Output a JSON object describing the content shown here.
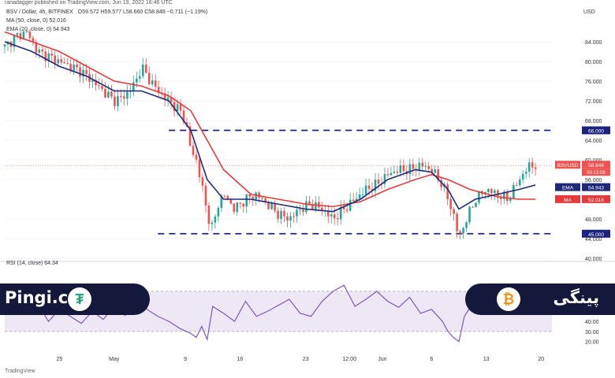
{
  "publisher_line": "ranadagger published on TradingView.com, Jun 19, 2022 16:46 UTC",
  "symbol_line": "BSV / Dollar, 4h, BITFINEX",
  "ohlc": "O59.572  H59.577  L58.660  C58.848  −0.711 (−1.19%)",
  "ma_line": "MA (50, close, 0)  52.016",
  "ema_line": "EMA (20, close, 0)  54.943",
  "rsi_line": "RSI (14, close)  64.34",
  "currency": "USD",
  "watermark_left": "Pingi.co",
  "watermark_right": "پینگی",
  "tradingview_logo": "TradingView",
  "colors": {
    "candle_up": "#26a69a",
    "candle_down": "#ef5350",
    "ema": "#1e2a78",
    "ma": "#e5393b",
    "level": "#1a237e",
    "rsi": "#7e57c2",
    "rsi_band": "#ede7f6"
  },
  "chart_data": {
    "type": "line",
    "price_axis": {
      "ticks": [
        "84.000",
        "80.000",
        "76.000",
        "72.000",
        "68.000",
        "64.000",
        "60.000",
        "56.000",
        "48.000",
        "44.000",
        "40.000"
      ],
      "min": 40,
      "max": 88
    },
    "rsi_axis": {
      "ticks": [
        "70.00",
        "60.00",
        "40.00",
        "30.00",
        "20.00"
      ],
      "min": 15,
      "max": 95,
      "band": [
        30,
        70
      ]
    },
    "x_ticks": [
      "25",
      "May",
      "9",
      "16",
      "23",
      "12:00",
      "Jun",
      "6",
      "13",
      "20"
    ],
    "levels": [
      {
        "label": "66.000",
        "value": 66
      },
      {
        "label": "45.000",
        "value": 45
      }
    ],
    "badges": [
      {
        "label": "BSVUSD",
        "value": "58.848",
        "sub": "03:13:09",
        "price": 58.85,
        "color": "#ef5350"
      },
      {
        "label": "EMA",
        "value": "54.943",
        "price": 54.94,
        "color": "#1e2a78"
      },
      {
        "label": "MA",
        "value": "52.016",
        "price": 52.02,
        "color": "#e5393b"
      }
    ],
    "rsi_badge": {
      "label": "RSI",
      "value": "64.34",
      "level": 64.34
    },
    "price_path": [
      [
        0,
        83
      ],
      [
        0.02,
        85
      ],
      [
        0.04,
        86
      ],
      [
        0.06,
        82
      ],
      [
        0.08,
        81
      ],
      [
        0.1,
        80
      ],
      [
        0.12,
        79
      ],
      [
        0.14,
        78
      ],
      [
        0.16,
        76
      ],
      [
        0.18,
        74
      ],
      [
        0.2,
        72
      ],
      [
        0.22,
        73
      ],
      [
        0.24,
        76
      ],
      [
        0.25,
        79
      ],
      [
        0.26,
        77
      ],
      [
        0.28,
        74
      ],
      [
        0.3,
        72
      ],
      [
        0.32,
        70
      ],
      [
        0.33,
        68
      ],
      [
        0.34,
        62
      ],
      [
        0.35,
        60
      ],
      [
        0.36,
        55
      ],
      [
        0.37,
        49
      ],
      [
        0.38,
        46
      ],
      [
        0.39,
        51
      ],
      [
        0.4,
        53
      ],
      [
        0.42,
        50
      ],
      [
        0.44,
        52
      ],
      [
        0.46,
        53
      ],
      [
        0.48,
        51
      ],
      [
        0.5,
        49
      ],
      [
        0.52,
        48
      ],
      [
        0.54,
        50
      ],
      [
        0.56,
        51
      ],
      [
        0.58,
        50
      ],
      [
        0.6,
        48
      ],
      [
        0.62,
        50
      ],
      [
        0.64,
        52
      ],
      [
        0.66,
        54
      ],
      [
        0.68,
        55
      ],
      [
        0.7,
        57
      ],
      [
        0.72,
        58
      ],
      [
        0.74,
        58
      ],
      [
        0.76,
        59
      ],
      [
        0.78,
        58
      ],
      [
        0.8,
        55
      ],
      [
        0.82,
        49
      ],
      [
        0.83,
        44
      ],
      [
        0.84,
        47
      ],
      [
        0.86,
        52
      ],
      [
        0.88,
        54
      ],
      [
        0.9,
        53
      ],
      [
        0.92,
        52
      ],
      [
        0.94,
        56
      ],
      [
        0.96,
        59
      ],
      [
        0.97,
        58.8
      ]
    ],
    "ema_path": [
      [
        0,
        84
      ],
      [
        0.05,
        82
      ],
      [
        0.1,
        79
      ],
      [
        0.15,
        77
      ],
      [
        0.2,
        74
      ],
      [
        0.25,
        74
      ],
      [
        0.3,
        72
      ],
      [
        0.34,
        66
      ],
      [
        0.37,
        56
      ],
      [
        0.4,
        52
      ],
      [
        0.45,
        52
      ],
      [
        0.5,
        51
      ],
      [
        0.55,
        50
      ],
      [
        0.6,
        49.5
      ],
      [
        0.65,
        52
      ],
      [
        0.7,
        56
      ],
      [
        0.75,
        58
      ],
      [
        0.78,
        57.5
      ],
      [
        0.81,
        54
      ],
      [
        0.83,
        50
      ],
      [
        0.86,
        52
      ],
      [
        0.9,
        53
      ],
      [
        0.94,
        54
      ],
      [
        0.97,
        54.9
      ]
    ],
    "ma_path": [
      [
        0,
        86
      ],
      [
        0.05,
        84
      ],
      [
        0.1,
        82
      ],
      [
        0.15,
        79
      ],
      [
        0.2,
        76
      ],
      [
        0.25,
        75
      ],
      [
        0.3,
        73
      ],
      [
        0.34,
        70
      ],
      [
        0.37,
        64
      ],
      [
        0.4,
        58
      ],
      [
        0.45,
        53
      ],
      [
        0.5,
        52
      ],
      [
        0.55,
        51
      ],
      [
        0.6,
        50.5
      ],
      [
        0.65,
        51.5
      ],
      [
        0.7,
        54
      ],
      [
        0.75,
        56
      ],
      [
        0.78,
        57
      ],
      [
        0.81,
        56
      ],
      [
        0.85,
        54
      ],
      [
        0.9,
        52.5
      ],
      [
        0.94,
        52
      ],
      [
        0.97,
        52.0
      ]
    ],
    "rsi_path": [
      [
        0,
        55
      ],
      [
        0.02,
        62
      ],
      [
        0.04,
        48
      ],
      [
        0.06,
        58
      ],
      [
        0.08,
        40
      ],
      [
        0.1,
        52
      ],
      [
        0.12,
        45
      ],
      [
        0.14,
        38
      ],
      [
        0.16,
        50
      ],
      [
        0.18,
        42
      ],
      [
        0.2,
        55
      ],
      [
        0.22,
        46
      ],
      [
        0.24,
        60
      ],
      [
        0.25,
        70
      ],
      [
        0.26,
        52
      ],
      [
        0.28,
        45
      ],
      [
        0.3,
        40
      ],
      [
        0.32,
        33
      ],
      [
        0.34,
        28
      ],
      [
        0.35,
        24
      ],
      [
        0.36,
        35
      ],
      [
        0.37,
        22
      ],
      [
        0.38,
        55
      ],
      [
        0.4,
        48
      ],
      [
        0.42,
        40
      ],
      [
        0.44,
        60
      ],
      [
        0.46,
        45
      ],
      [
        0.48,
        50
      ],
      [
        0.5,
        56
      ],
      [
        0.52,
        62
      ],
      [
        0.54,
        48
      ],
      [
        0.56,
        45
      ],
      [
        0.58,
        60
      ],
      [
        0.6,
        70
      ],
      [
        0.62,
        76
      ],
      [
        0.64,
        55
      ],
      [
        0.66,
        62
      ],
      [
        0.68,
        70
      ],
      [
        0.7,
        60
      ],
      [
        0.72,
        54
      ],
      [
        0.74,
        64
      ],
      [
        0.76,
        48
      ],
      [
        0.78,
        52
      ],
      [
        0.8,
        40
      ],
      [
        0.81,
        30
      ],
      [
        0.82,
        24
      ],
      [
        0.83,
        20
      ],
      [
        0.84,
        45
      ],
      [
        0.86,
        62
      ],
      [
        0.88,
        55
      ],
      [
        0.9,
        48
      ],
      [
        0.92,
        60
      ],
      [
        0.94,
        63
      ],
      [
        0.96,
        70
      ],
      [
        0.97,
        64.3
      ]
    ]
  }
}
